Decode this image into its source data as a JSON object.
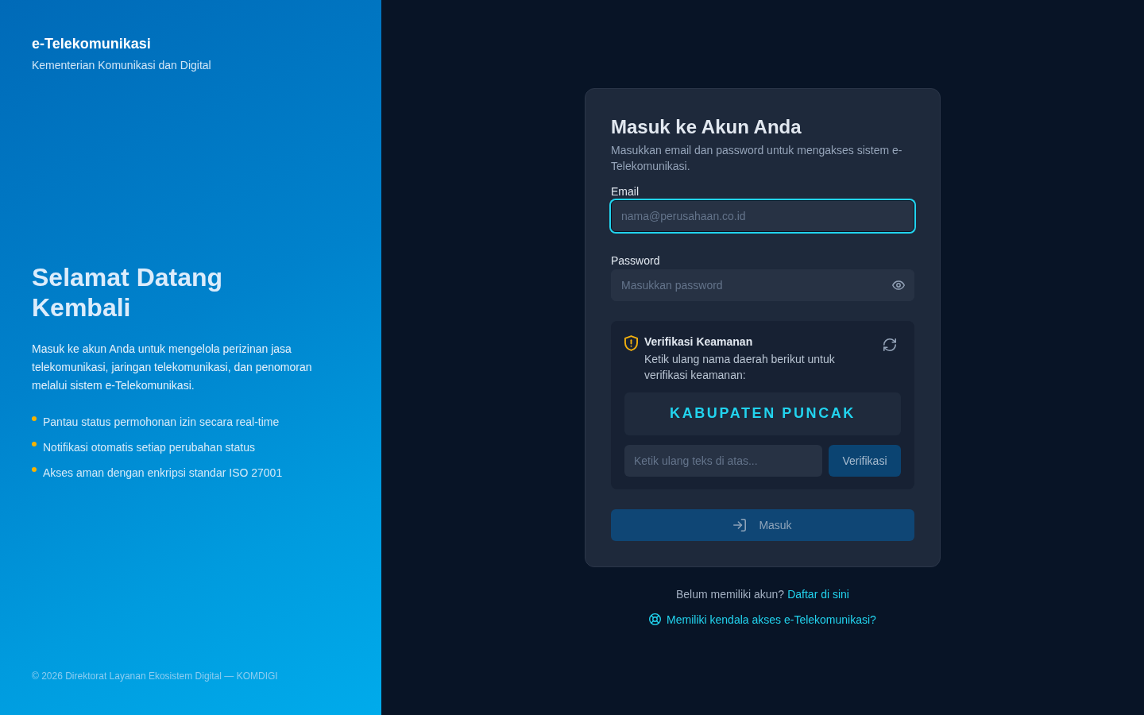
{
  "brand": {
    "name": "e-Telekomunikasi",
    "subtitle": "Kementerian Komunikasi dan Digital"
  },
  "hero": {
    "title": "Selamat Datang Kembali",
    "description": "Masuk ke akun Anda untuk mengelola perizinan jasa telekomunikasi, jaringan telekomunikasi, dan penomoran melalui sistem e-Telekomunikasi.",
    "features": [
      "Pantau status permohonan izin secara real-time",
      "Notifikasi otomatis setiap perubahan status",
      "Akses aman dengan enkripsi standar ISO 27001"
    ]
  },
  "footer": {
    "copyright": "© 2026 Direktorat Layanan Ekosistem Digital — KOMDIGI"
  },
  "login": {
    "title": "Masuk ke Akun Anda",
    "subtitle": "Masukkan email dan password untuk mengakses sistem e-Telekomunikasi.",
    "fields": [
      {
        "kind": "email",
        "label": "Email",
        "placeholder": "nama@perusahaan.co.id",
        "focused": true
      },
      {
        "kind": "password",
        "label": "Password",
        "placeholder": "Masukkan password",
        "focused": false
      }
    ],
    "captcha": {
      "title": "Verifikasi Keamanan",
      "instruction": "Ketik ulang nama daerah berikut untuk verifikasi keamanan:",
      "challenge": "KABUPATEN PUNCAK",
      "placeholder": "Ketik ulang teks di atas...",
      "button": "Verifikasi"
    },
    "submit": {
      "label": "Masuk",
      "disabled": true
    }
  },
  "register": {
    "prompt": "Belum memiliki akun?",
    "link": "Daftar di sini"
  },
  "help": {
    "link": "Memiliki kendala akses e-Telekomunikasi?"
  }
}
